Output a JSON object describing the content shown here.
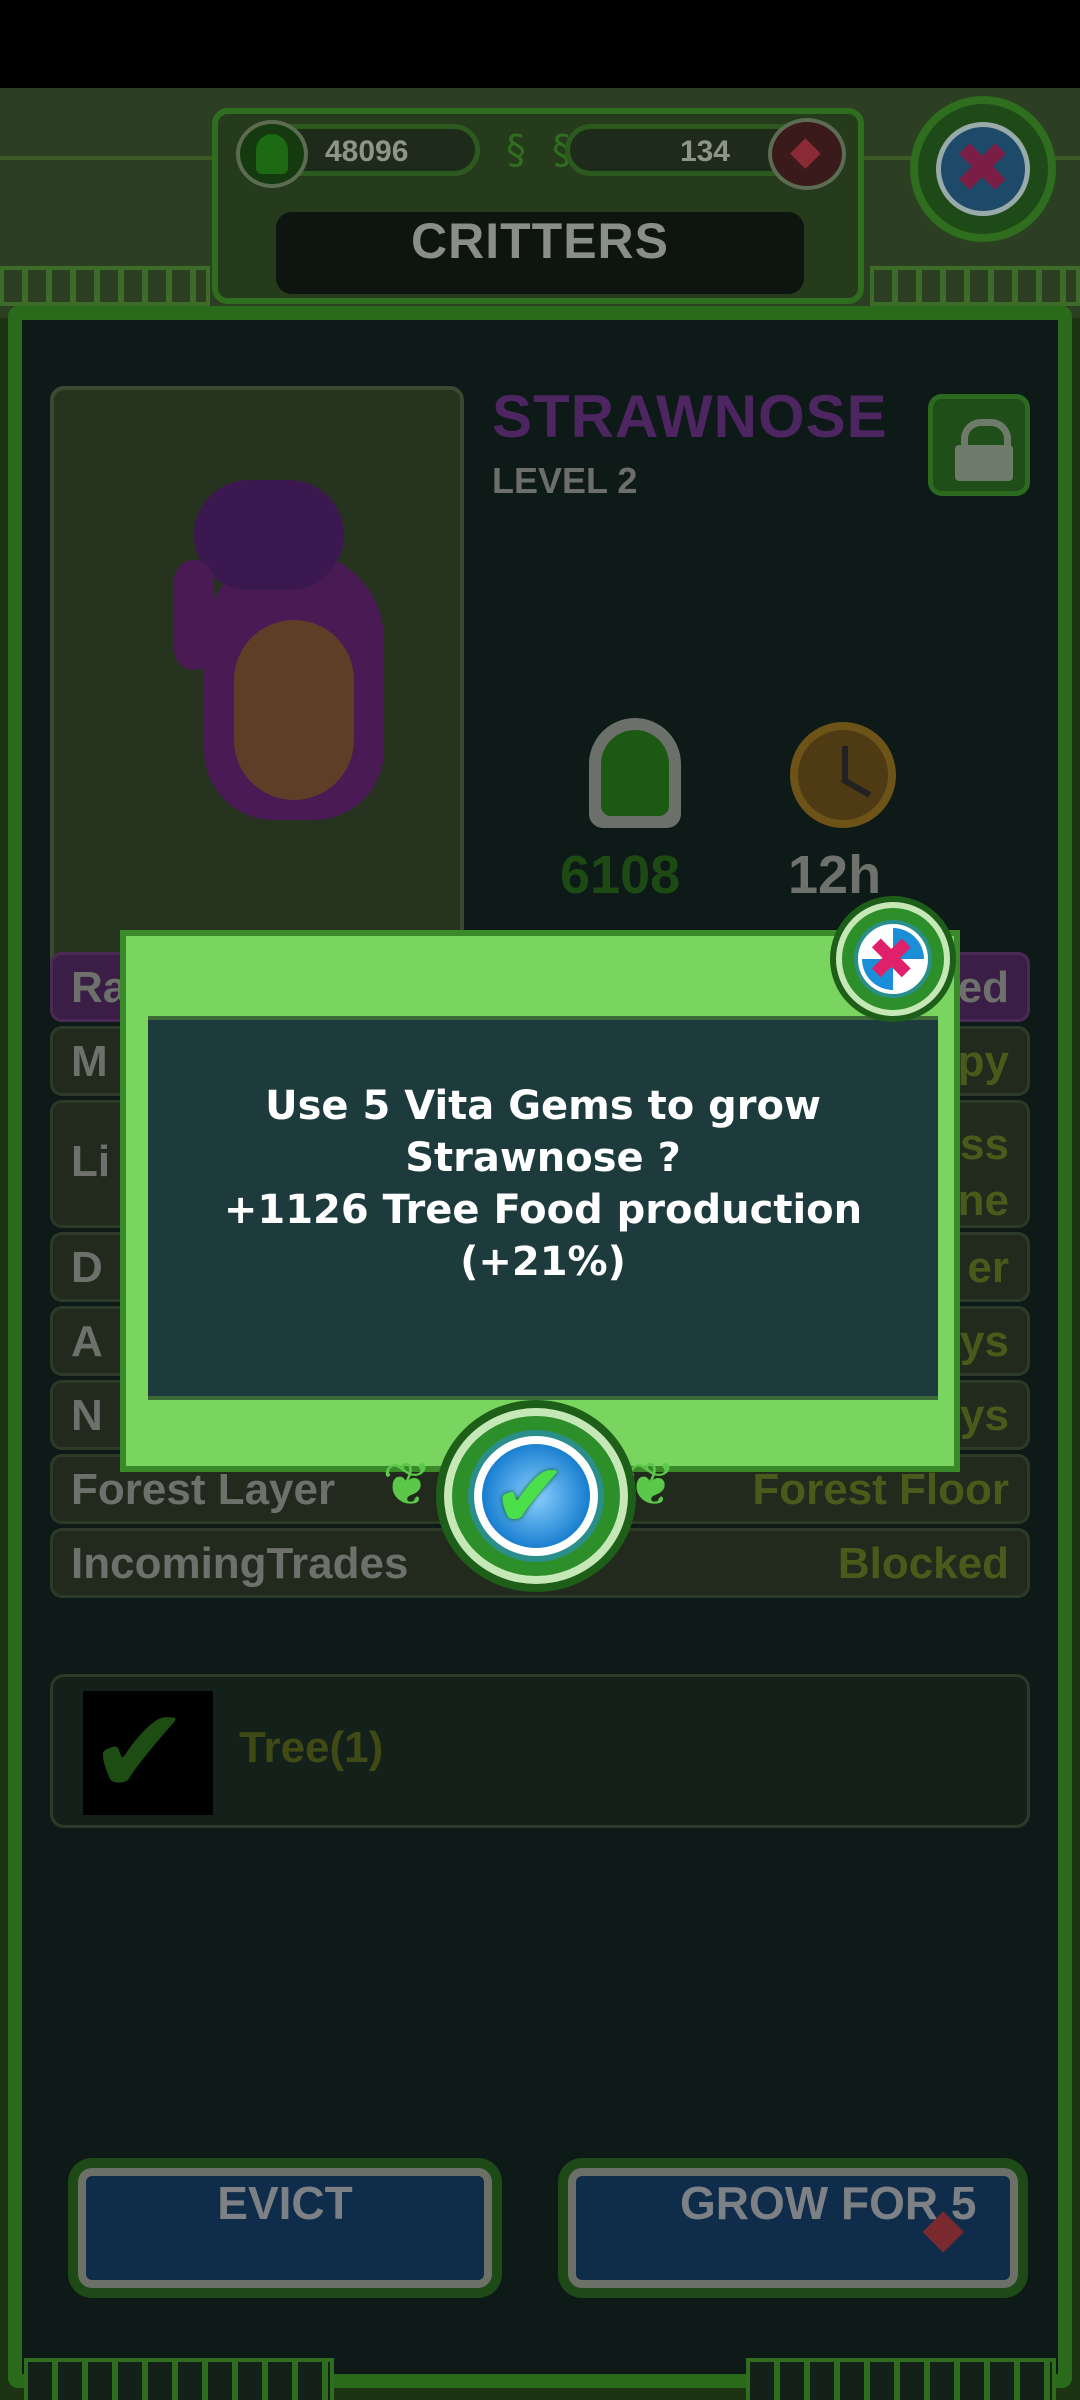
{
  "header": {
    "title": "CRITTERS",
    "tree_food": "48096",
    "vita_gems": "134"
  },
  "critter": {
    "name": "STRAWNOSE",
    "level": "LEVEL 2",
    "food_production": "6108",
    "grow_time": "12h"
  },
  "details": {
    "rows": [
      {
        "label": "Ra",
        "value": "ed"
      },
      {
        "label": "M",
        "value": "py"
      },
      {
        "label": "Li",
        "value_line1": "ss",
        "value_line2": "ne"
      },
      {
        "label": "D",
        "value": "er"
      },
      {
        "label": "A",
        "value": "ys"
      },
      {
        "label": "N",
        "value": "ys"
      },
      {
        "label": "Forest Layer",
        "value": "Forest Floor"
      },
      {
        "label": "IncomingTrades",
        "value": "Blocked"
      }
    ],
    "tree_item": "Tree(1)"
  },
  "buttons": {
    "evict": "EVICT",
    "grow": "GROW FOR 5"
  },
  "modal": {
    "line1": "Use 5 Vita Gems to grow",
    "line2": "Strawnose ?",
    "line3": "+1126 Tree Food production",
    "line4": "(+21%)"
  }
}
